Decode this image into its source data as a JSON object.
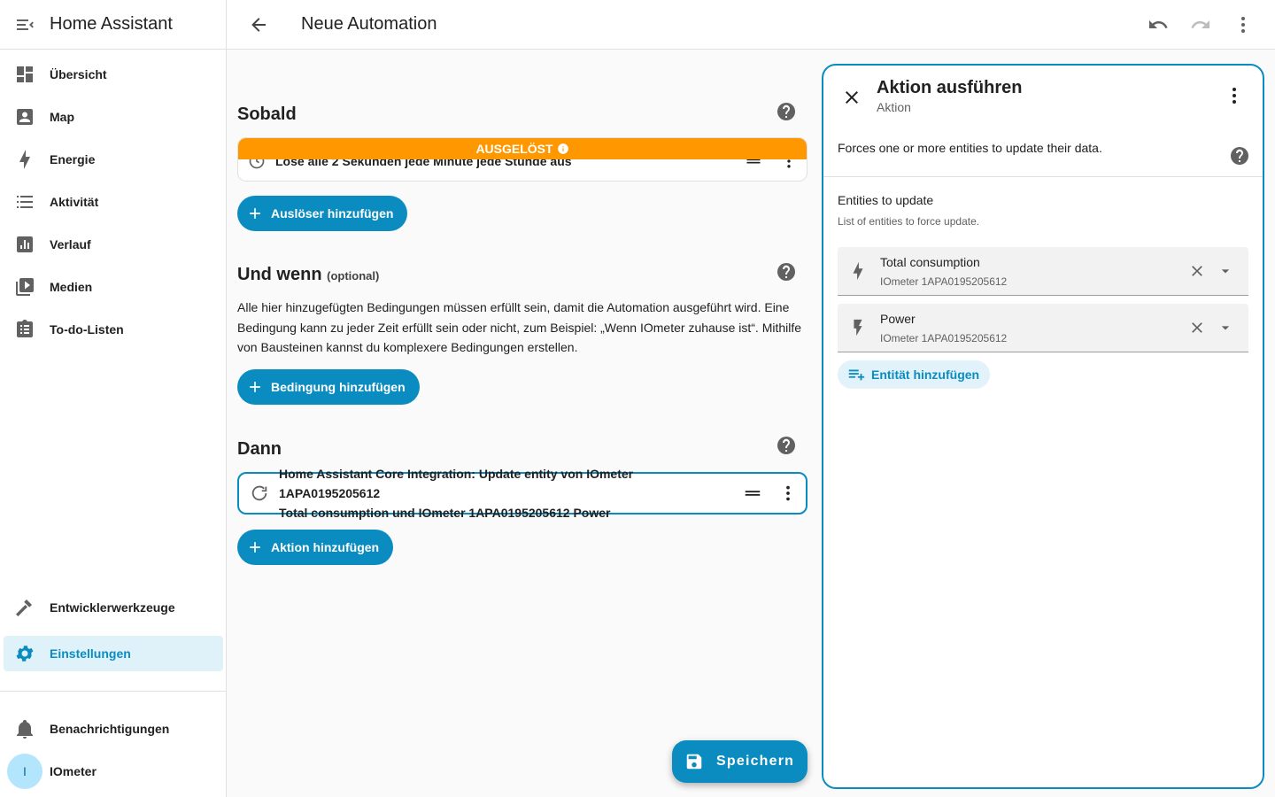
{
  "sidebar": {
    "title": "Home Assistant",
    "items": [
      {
        "label": "Übersicht",
        "icon": "dashboard-icon"
      },
      {
        "label": "Map",
        "icon": "account-box-icon"
      },
      {
        "label": "Energie",
        "icon": "lightning-bolt-icon"
      },
      {
        "label": "Aktivität",
        "icon": "format-list-icon"
      },
      {
        "label": "Verlauf",
        "icon": "chart-box-icon"
      },
      {
        "label": "Medien",
        "icon": "play-box-multiple-icon"
      },
      {
        "label": "To-do-Listen",
        "icon": "clipboard-list-icon"
      }
    ],
    "developer_tools": "Entwicklerwerkzeuge",
    "settings": "Einstellungen",
    "notifications": "Benachrichtigungen",
    "user": {
      "initial": "I",
      "name": "IOmeter"
    }
  },
  "topbar": {
    "title": "Neue Automation"
  },
  "editor": {
    "triggers": {
      "title": "Sobald",
      "banner": "AUSGELÖST",
      "row_text": "Löse alle 2 Sekunden jede Minute jede Stunde aus",
      "add_label": "Auslöser hinzufügen"
    },
    "conditions": {
      "title": "Und wenn",
      "optional": "(optional)",
      "description": "Alle hier hinzugefügten Bedingungen müssen erfüllt sein, damit die Automation ausgeführt wird. Eine Bedingung kann zu jeder Zeit erfüllt sein oder nicht, zum Beispiel: „Wenn IOmeter zuhause ist“. Mithilfe von Bausteinen kannst du komplexere Bedingungen erstellen.",
      "add_label": "Bedingung hinzufügen"
    },
    "actions": {
      "title": "Dann",
      "item_line1": "Home Assistant Core Integration: Update entity von IOmeter 1APA0195205612",
      "item_line2": "Total consumption und IOmeter 1APA0195205612 Power",
      "add_label": "Aktion hinzufügen"
    },
    "save_label": "Speichern"
  },
  "panel": {
    "title": "Aktion ausführen",
    "subtitle": "Aktion",
    "description": "Forces one or more entities to update their data.",
    "field_label": "Entities to update",
    "field_hint": "List of entities to force update.",
    "entities": [
      {
        "name": "Total consumption",
        "device": "IOmeter 1APA0195205612"
      },
      {
        "name": "Power",
        "device": "IOmeter 1APA0195205612"
      }
    ],
    "add_entity_label": "Entität hinzufügen"
  },
  "colors": {
    "primary": "#0b8cc1",
    "triggered": "#ff9800",
    "active_bg": "#dff2f9"
  }
}
